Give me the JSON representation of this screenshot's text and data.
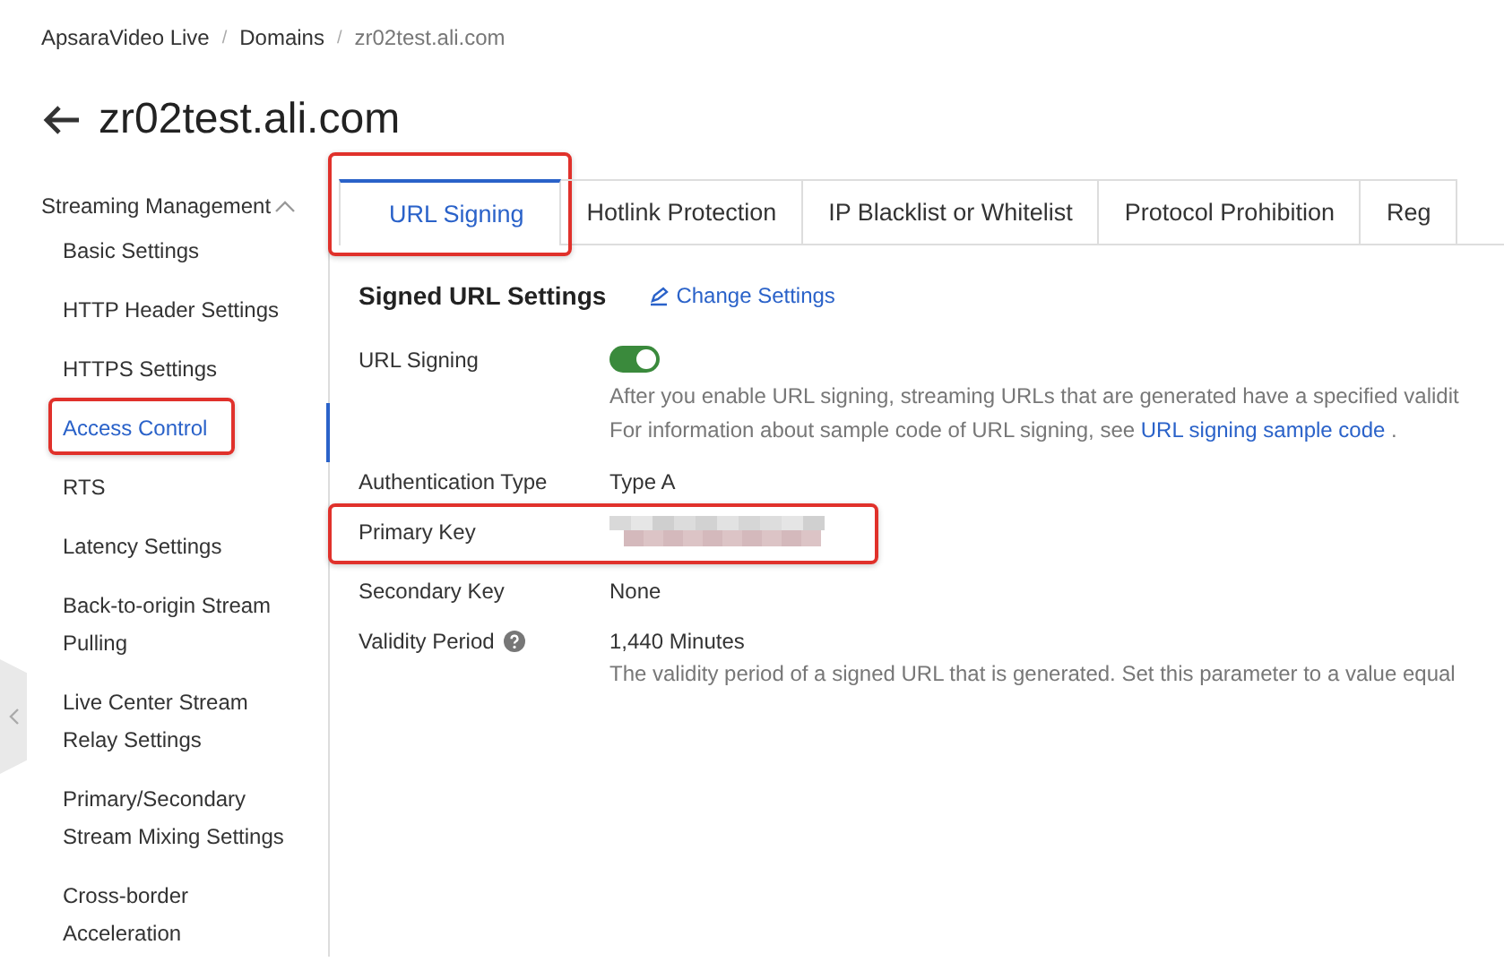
{
  "breadcrumb": [
    "ApsaraVideo Live",
    "Domains",
    "zr02test.ali.com"
  ],
  "breadcrumb_separator": "/",
  "title": "zr02test.ali.com",
  "sidebar": {
    "group": {
      "label": "Streaming Management",
      "expanded": true
    },
    "items": [
      {
        "label": "Basic Settings",
        "selected": false,
        "highlighted": false
      },
      {
        "label": "HTTP Header Settings",
        "selected": false,
        "highlighted": false
      },
      {
        "label": "HTTPS Settings",
        "selected": false,
        "highlighted": false
      },
      {
        "label": "Access Control",
        "selected": true,
        "highlighted": true
      },
      {
        "label": "RTS",
        "selected": false,
        "highlighted": false
      },
      {
        "label": "Latency Settings",
        "selected": false,
        "highlighted": false
      },
      {
        "label": "Back-to-origin Stream Pulling",
        "selected": false,
        "highlighted": false
      },
      {
        "label": "Live Center Stream Relay Settings",
        "selected": false,
        "highlighted": false
      },
      {
        "label": "Primary/Secondary Stream Mixing Settings",
        "selected": false,
        "highlighted": false
      },
      {
        "label": "Cross-border Acceleration",
        "selected": false,
        "highlighted": false
      }
    ]
  },
  "tabs": [
    {
      "label": "URL Signing",
      "selected": true,
      "highlighted": true
    },
    {
      "label": "Hotlink Protection",
      "selected": false,
      "highlighted": false
    },
    {
      "label": "IP Blacklist or Whitelist",
      "selected": false,
      "highlighted": false
    },
    {
      "label": "Protocol Prohibition",
      "selected": false,
      "highlighted": false
    },
    {
      "label": "Reg",
      "selected": false,
      "highlighted": false
    }
  ],
  "section": {
    "title": "Signed URL Settings",
    "action": "Change Settings"
  },
  "fields": [
    {
      "kind": "toggle",
      "label": "URL Signing",
      "on": true,
      "highlighted": false,
      "help": false,
      "description": [
        "After you enable URL signing, streaming URLs that are generated have a specified validit",
        "For information about sample code of URL signing, see "
      ],
      "link": "URL signing sample code",
      "after_link": "."
    },
    {
      "kind": "text",
      "label": "Authentication Type",
      "value": "Type A",
      "highlighted": false,
      "help": false
    },
    {
      "kind": "masked",
      "label": "Primary Key",
      "highlighted": true,
      "help": false
    },
    {
      "kind": "text",
      "label": "Secondary Key",
      "value": "None",
      "highlighted": false,
      "help": false
    },
    {
      "kind": "text",
      "label": "Validity Period",
      "value": "1,440 Minutes",
      "highlighted": false,
      "help": true,
      "description": [
        "The validity period of a signed URL that is generated. Set this parameter to a value equal"
      ]
    }
  ]
}
